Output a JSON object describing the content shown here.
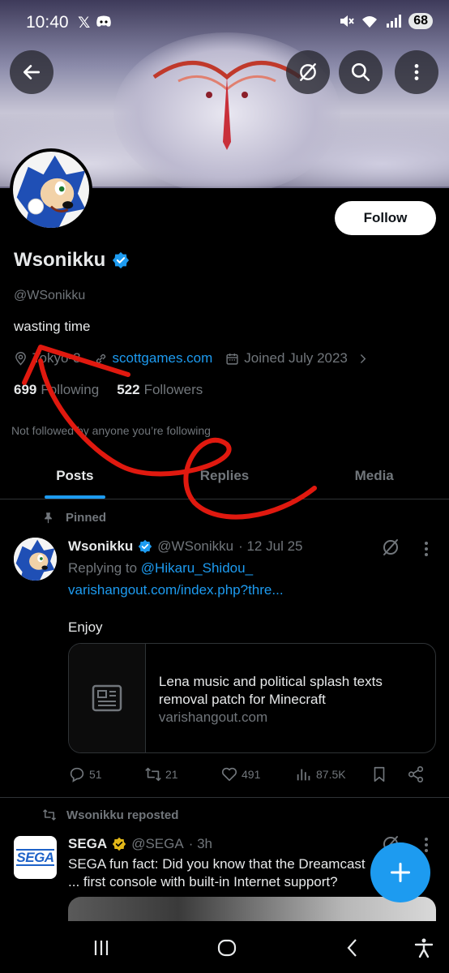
{
  "status_bar": {
    "time": "10:40",
    "x_icon": "x-logo",
    "battery": "68"
  },
  "header": {
    "back_icon": "arrow-left-icon",
    "grok_icon": "grok-icon",
    "search_icon": "search-icon",
    "more_icon": "more-vertical-icon"
  },
  "profile": {
    "follow_label": "Follow",
    "display_name": "Wsonikku",
    "handle": "@WSonikku",
    "bio": "wasting time",
    "location": "Tokyo-3",
    "website": "scottgames.com",
    "joined": "Joined July 2023",
    "following_count": "699",
    "following_label": "Following",
    "followers_count": "522",
    "followers_label": "Followers",
    "not_followed": "Not followed by anyone you’re following"
  },
  "tabs": [
    {
      "label": "Posts",
      "active": true
    },
    {
      "label": "Replies",
      "active": false
    },
    {
      "label": "Media",
      "active": false
    }
  ],
  "pinned_post": {
    "pinned_label": "Pinned",
    "author": "Wsonikku",
    "handle": "@WSonikku",
    "date": "· 12 Jul 25",
    "replying_prefix": "Replying to",
    "replying_to": "@Hikaru_Shidou_",
    "link": "varishangout.com/index.php?thre...",
    "text": "Enjoy",
    "card_title": "Lena music and political splash texts removal patch for Minecraft",
    "card_domain": "varishangout.com",
    "replies": "51",
    "reposts": "21",
    "likes": "491",
    "views": "87.5K"
  },
  "repost": {
    "label": "Wsonikku reposted",
    "author": "SEGA",
    "handle": "@SEGA",
    "time": "· 3h",
    "avatar_text": "SEGA",
    "text": "SEGA fun fact: Did you know that the Dreamcast ... first console with built-in Internet support?"
  },
  "colors": {
    "accent": "#1d9bf0",
    "background": "#000000",
    "muted": "#71767b",
    "annotation": "#e0190f"
  }
}
